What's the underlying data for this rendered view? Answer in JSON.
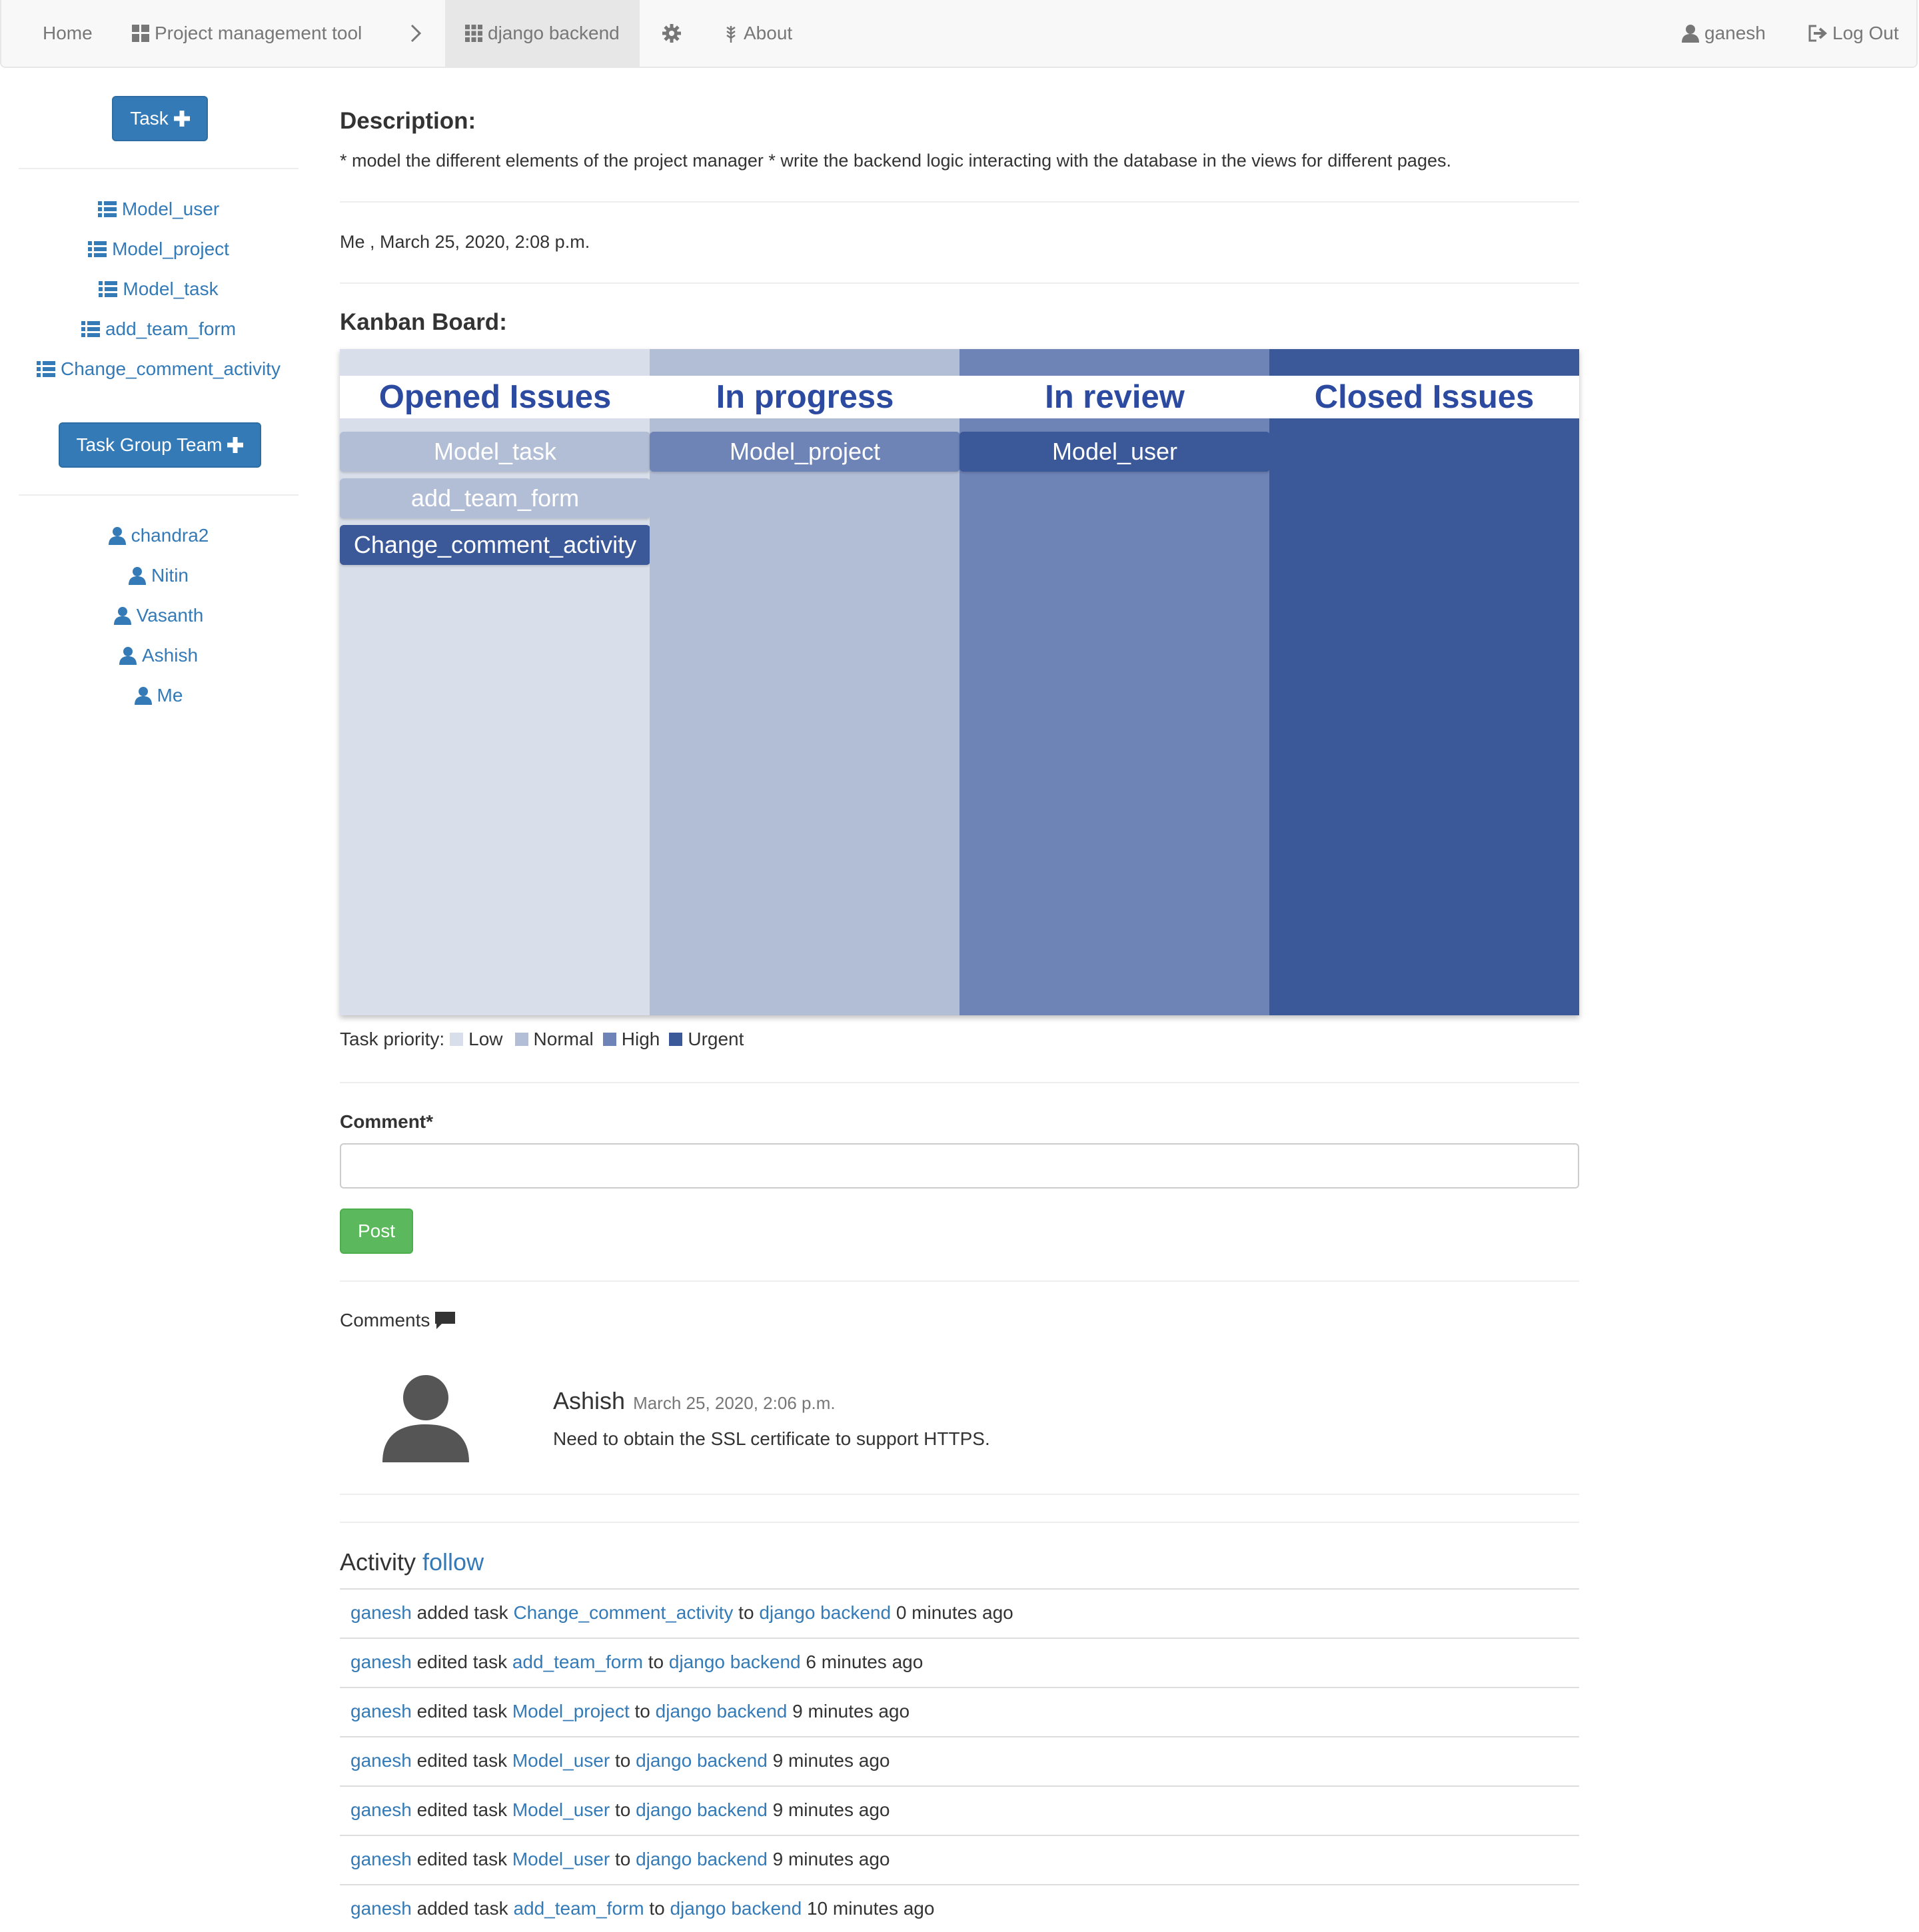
{
  "navbar": {
    "home": "Home",
    "project": "Project management tool",
    "current": "django backend",
    "about": "About",
    "user": "ganesh",
    "logout": "Log Out"
  },
  "sidebar": {
    "task_button": "Task",
    "tasks": [
      "Model_user",
      "Model_project",
      "Model_task",
      "add_team_form",
      "Change_comment_activity"
    ],
    "team_button": "Task Group Team",
    "members": [
      "chandra2",
      "Nitin",
      "Vasanth",
      "Ashish",
      "Me"
    ]
  },
  "main": {
    "description_heading": "Description:",
    "description": "* model the different elements of the project manager * write the backend logic interacting with the database in the views for different pages.",
    "created_by": "Me , March 25, 2020, 2:08 p.m.",
    "kanban_heading": "Kanban Board:"
  },
  "kanban": {
    "columns": [
      {
        "title": "Opened Issues",
        "color": "#d9dfea",
        "cards": [
          {
            "label": "Model_task",
            "color": "#b2bdd6"
          },
          {
            "label": "add_team_form",
            "color": "#b2bdd6"
          },
          {
            "label": "Change_comment_activity",
            "color": "#3b5898"
          }
        ]
      },
      {
        "title": "In progress",
        "color": "#b2bdd6",
        "cards": [
          {
            "label": "Model_project",
            "color": "#6e83b6"
          }
        ]
      },
      {
        "title": "In review",
        "color": "#6e83b6",
        "cards": [
          {
            "label": "Model_user",
            "color": "#3b5898"
          }
        ]
      },
      {
        "title": "Closed Issues",
        "color": "#3b5898",
        "cards": []
      }
    ]
  },
  "legend": {
    "label": "Task priority:",
    "items": [
      {
        "label": "Low",
        "color": "#d9dfea"
      },
      {
        "label": "Normal",
        "color": "#b2bdd6"
      },
      {
        "label": "High",
        "color": "#6e83b6"
      },
      {
        "label": "Urgent",
        "color": "#3b5898"
      }
    ]
  },
  "comment_form": {
    "label": "Comment*",
    "value": "",
    "post_button": "Post"
  },
  "comments": {
    "heading": "Comments",
    "items": [
      {
        "author": "Ashish",
        "date": "March 25, 2020, 2:06 p.m.",
        "text": "Need to obtain the SSL certificate to support HTTPS."
      }
    ]
  },
  "activity": {
    "heading": "Activity",
    "follow": "follow",
    "rows": [
      {
        "user": "ganesh",
        "verb": "added task",
        "task": "Change_comment_activity",
        "to": "to",
        "project": "django backend",
        "time": "0 minutes ago"
      },
      {
        "user": "ganesh",
        "verb": "edited task",
        "task": "add_team_form",
        "to": "to",
        "project": "django backend",
        "time": "6 minutes ago"
      },
      {
        "user": "ganesh",
        "verb": "edited task",
        "task": "Model_project",
        "to": "to",
        "project": "django backend",
        "time": "9 minutes ago"
      },
      {
        "user": "ganesh",
        "verb": "edited task",
        "task": "Model_user",
        "to": "to",
        "project": "django backend",
        "time": "9 minutes ago"
      },
      {
        "user": "ganesh",
        "verb": "edited task",
        "task": "Model_user",
        "to": "to",
        "project": "django backend",
        "time": "9 minutes ago"
      },
      {
        "user": "ganesh",
        "verb": "edited task",
        "task": "Model_user",
        "to": "to",
        "project": "django backend",
        "time": "9 minutes ago"
      },
      {
        "user": "ganesh",
        "verb": "added task",
        "task": "add_team_form",
        "to": "to",
        "project": "django backend",
        "time": "10 minutes ago"
      }
    ]
  },
  "colors": {
    "link": "#337ab7",
    "primary": "#337ab7",
    "success": "#5cb85c",
    "kanban_title": "#2b4aa0"
  }
}
